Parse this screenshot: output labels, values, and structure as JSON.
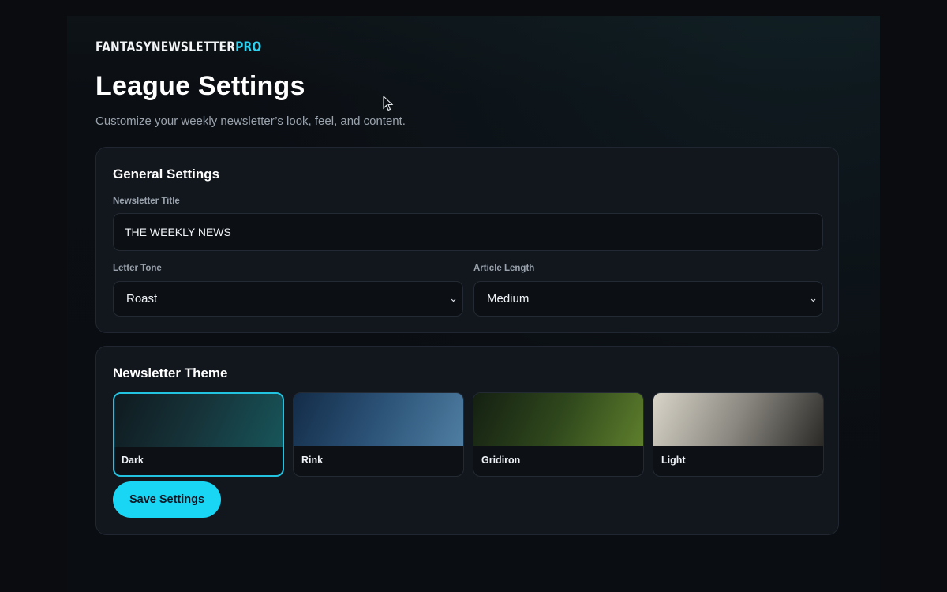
{
  "brand": {
    "part1": "FANTASYNEWSLETTER",
    "part2": "PRO"
  },
  "page": {
    "title": "League Settings",
    "subtitle": "Customize your weekly newsletter’s look, feel, and content."
  },
  "general": {
    "heading": "General Settings",
    "newsletter_title": {
      "label": "Newsletter Title",
      "value": "THE WEEKLY NEWS"
    },
    "letter_tone": {
      "label": "Letter Tone",
      "selected": "Roast",
      "icon": "chevron-down-icon"
    },
    "article_length": {
      "label": "Article Length",
      "selected": "Medium",
      "icon": "chevron-down-icon"
    }
  },
  "theme": {
    "heading": "Newsletter Theme",
    "selected": "Dark",
    "options": [
      {
        "name": "Dark",
        "gradient": [
          "#0f1a1f",
          "#16343a",
          "#17555a"
        ]
      },
      {
        "name": "Rink",
        "gradient": [
          "#132c48",
          "#2c5378",
          "#4f7ea2"
        ]
      },
      {
        "name": "Gridiron",
        "gradient": [
          "#142012",
          "#2f471c",
          "#5e7f2c"
        ]
      },
      {
        "name": "Light",
        "gradient": [
          "#d8d4c8",
          "#8a8780",
          "#2a2926"
        ]
      }
    ]
  },
  "actions": {
    "save_label": "Save Settings"
  },
  "colors": {
    "accent": "#19d6f5",
    "panel": "#12171d",
    "background": "#0a0c10"
  }
}
